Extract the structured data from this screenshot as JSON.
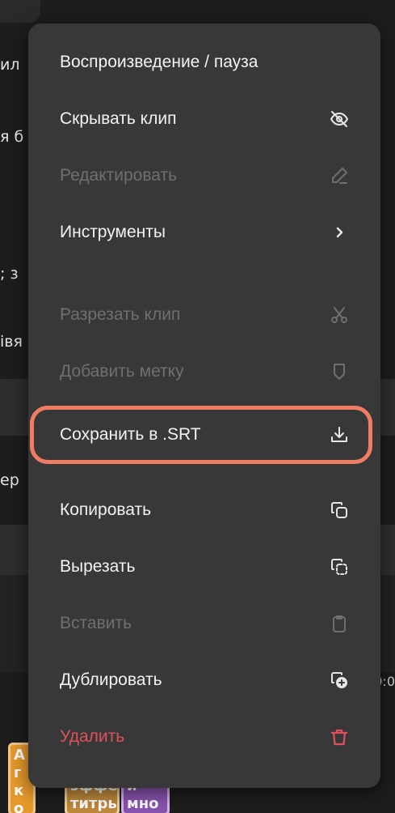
{
  "background": {
    "fragments": [
      "ил",
      "я б",
      "; з",
      "івя",
      "ер",
      "0:0"
    ],
    "clips": [
      "А г к о",
      "эффек титры",
      "и мно"
    ]
  },
  "menu": {
    "items": [
      {
        "label": "Воспроизведение / пауза",
        "icon": "",
        "state": "normal"
      },
      {
        "label": "Скрывать клип",
        "icon": "eye-off-icon",
        "state": "normal"
      },
      {
        "label": "Редактировать",
        "icon": "pencil-icon",
        "state": "disabled"
      },
      {
        "label": "Инструменты",
        "icon": "chevron-right-icon",
        "state": "normal"
      },
      {
        "label": "Разрезать клип",
        "icon": "scissors-icon",
        "state": "disabled"
      },
      {
        "label": "Добавить метку",
        "icon": "marker-icon",
        "state": "disabled"
      },
      {
        "label": "Сохранить в .SRT",
        "icon": "download-icon",
        "state": "highlighted"
      },
      {
        "label": "Копировать",
        "icon": "copy-icon",
        "state": "normal"
      },
      {
        "label": "Вырезать",
        "icon": "cut-copy-icon",
        "state": "normal"
      },
      {
        "label": "Вставить",
        "icon": "clipboard-icon",
        "state": "disabled"
      },
      {
        "label": "Дублировать",
        "icon": "duplicate-icon",
        "state": "normal"
      },
      {
        "label": "Удалить",
        "icon": "trash-icon",
        "state": "danger"
      }
    ]
  },
  "colors": {
    "menu_bg": "#383838",
    "highlight": "#f07d63",
    "danger": "#e0505b",
    "disabled": "#6f6f6f"
  }
}
